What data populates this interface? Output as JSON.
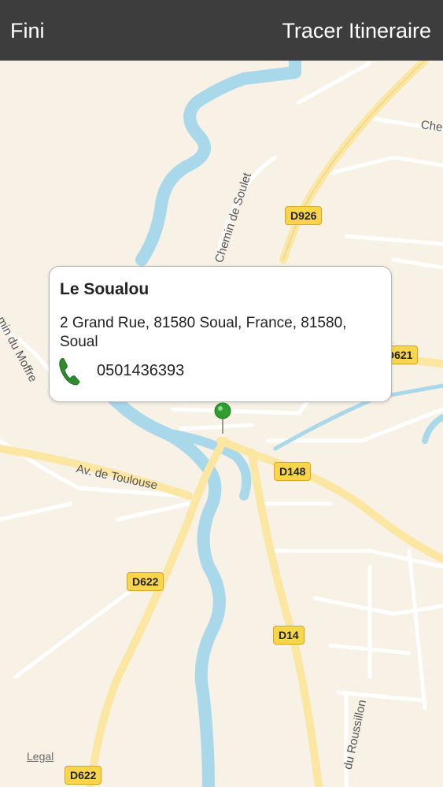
{
  "navbar": {
    "left_button": "Fini",
    "right_button": "Tracer Itineraire",
    "background": "#3d3d3d"
  },
  "map": {
    "road_labels": {
      "chemin_de_soulet": "Chemin de Soulet",
      "chemin_du_moffre": "min du Moffre",
      "av_de_toulouse": "Av. de Toulouse",
      "du_roussillon": "du Roussillon",
      "che": "Che"
    },
    "shields": {
      "d926": "D926",
      "d621": "D621",
      "d148": "D148",
      "d622_a": "D622",
      "d14": "D14",
      "d622_b": "D622"
    },
    "legal": "Legal",
    "colors": {
      "land": "#f7f1e6",
      "water": "#a8d8ea",
      "major_road": "#fbe6a2",
      "minor_road": "#ffffff",
      "shield": "#f8d54a"
    }
  },
  "callout": {
    "title": "Le Soualou",
    "address": "2 Grand Rue, 81580 Soual, France, 81580, Soual",
    "phone": "0501436393"
  },
  "pin": {
    "color": "#2e9e2e"
  }
}
